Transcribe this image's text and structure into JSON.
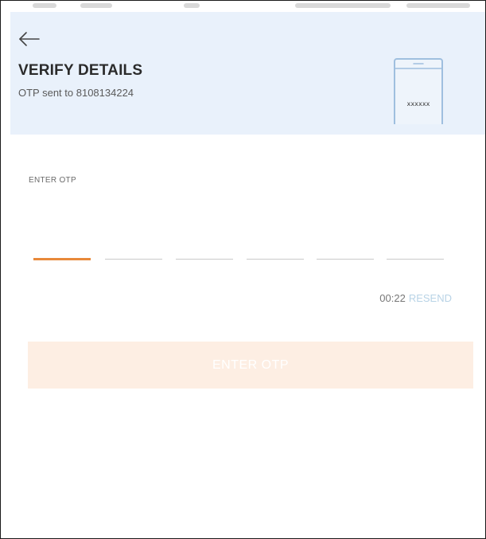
{
  "header": {
    "title": "VERIFY DETAILS",
    "subtitle": "OTP sent to 8108134224",
    "phone_mask": "xxxxxx"
  },
  "otp": {
    "label": "ENTER OTP",
    "digit_count": 6,
    "active_index": 0
  },
  "timer": {
    "countdown": "00:22",
    "resend_label": "RESEND"
  },
  "submit": {
    "label": "ENTER OTP"
  },
  "colors": {
    "header_bg": "#e9f1fb",
    "accent_orange": "#e8893a",
    "button_bg_disabled": "#fdeee3",
    "resend_disabled": "#b8d3e6",
    "phone_outline": "#9fbfdf"
  },
  "icons": {
    "back": "arrow-left-icon",
    "phone": "phone-icon"
  }
}
